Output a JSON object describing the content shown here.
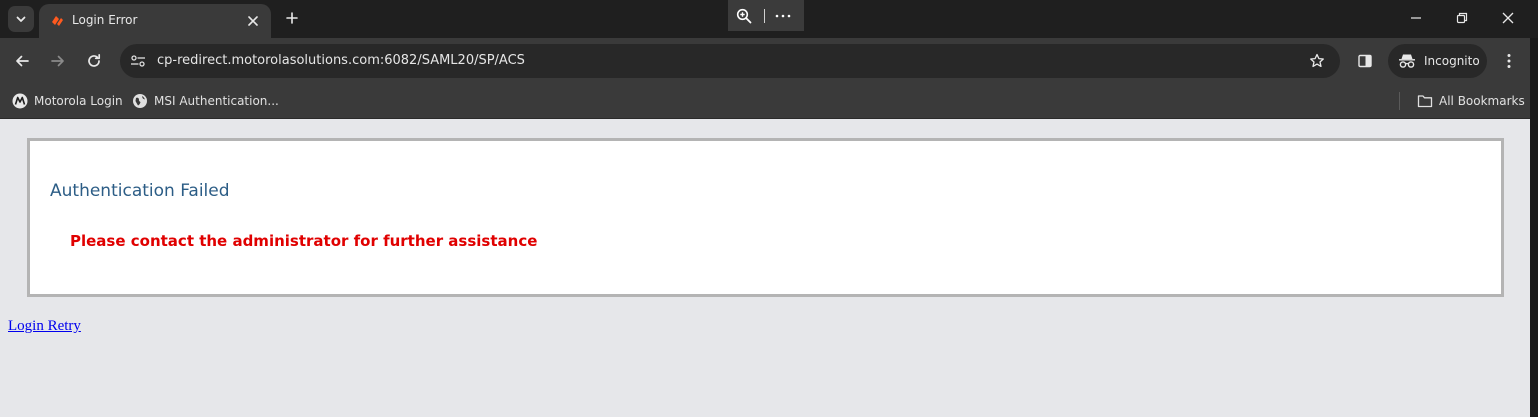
{
  "browser": {
    "tab": {
      "title": "Login Error",
      "favicon": "orange-diamond-icon"
    },
    "address_bar": {
      "url": "cp-redirect.motorolasolutions.com:6082/SAML20/SP/ACS"
    },
    "profile": {
      "label": "Incognito"
    },
    "bookmarks": [
      {
        "label": "Motorola Login",
        "icon": "motorola-logo-icon"
      },
      {
        "label": "MSI Authentication...",
        "icon": "globe-icon"
      }
    ],
    "all_bookmarks_label": "All Bookmarks",
    "colors": {
      "frame": "#1f1f1f",
      "toolbar": "#3a3a3a",
      "omnibox": "#282828",
      "tab_accent": "#ff5a1f"
    }
  },
  "page": {
    "error_title": "Authentication Failed",
    "error_message": "Please contact the administrator for further assistance",
    "retry_link": "Login Retry",
    "colors": {
      "background": "#e6e7ea",
      "title": "#2c5d86",
      "message": "#e00000",
      "link": "#0000ee"
    }
  }
}
